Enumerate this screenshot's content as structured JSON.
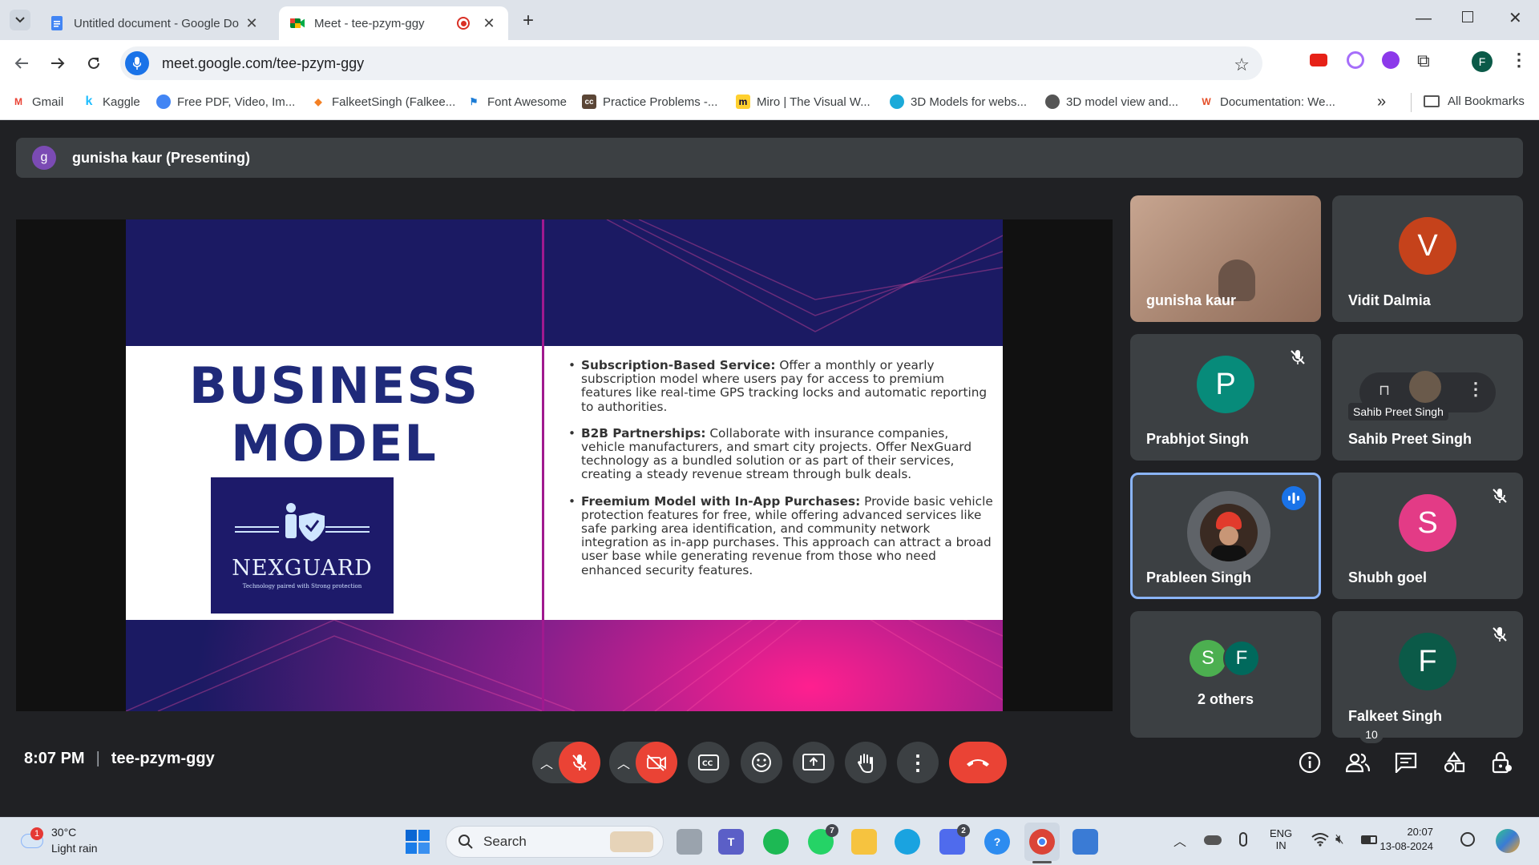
{
  "tabs": [
    {
      "title": "Untitled document - Google Do",
      "active": false
    },
    {
      "title": "Meet - tee-pzym-ggy",
      "active": true
    }
  ],
  "address": {
    "url": "meet.google.com/tee-pzym-ggy"
  },
  "profile_initial": "F",
  "bookmarks": [
    {
      "label": "Gmail",
      "color": "#ea4335",
      "glyph": "M"
    },
    {
      "label": "Kaggle",
      "color": "#20beff",
      "glyph": "k"
    },
    {
      "label": "Free PDF, Video, Im...",
      "color": "#4285f4",
      "glyph": "◐"
    },
    {
      "label": "FalkeetSingh (Falkee...",
      "color": "#f48024",
      "glyph": "◆"
    },
    {
      "label": "Font Awesome",
      "color": "#1c7cd6",
      "glyph": "⚑"
    },
    {
      "label": "Practice Problems -...",
      "color": "#5b4636",
      "glyph": "cc"
    },
    {
      "label": "Miro | The Visual W...",
      "color": "#ffd02f",
      "glyph": "m"
    },
    {
      "label": "3D Models for webs...",
      "color": "#1caad9",
      "glyph": "◉"
    },
    {
      "label": "3D model view and...",
      "color": "#555555",
      "glyph": "◍"
    },
    {
      "label": "Documentation: We...",
      "color": "#e44d26",
      "glyph": "W"
    }
  ],
  "all_bookmarks": "All Bookmarks",
  "presenting": {
    "initial": "g",
    "label": "gunisha kaur (Presenting)"
  },
  "slide": {
    "title_line1": "BUSINESS",
    "title_line2": "MODEL",
    "logo_name": "NEXGUARD",
    "logo_tagline": "Technology paired with Strong protection",
    "bullets": [
      {
        "head": "Subscription-Based Service:",
        "body": " Offer a monthly or yearly subscription model where users pay for access to premium features like real-time GPS tracking locks and automatic reporting to authorities."
      },
      {
        "head": "B2B Partnerships:",
        "body": " Collaborate with insurance companies, vehicle manufacturers, and smart city projects. Offer NexGuard technology as a bundled solution or as part of their services, creating a steady revenue stream through bulk deals."
      },
      {
        "head": "Freemium Model with In-App Purchases:",
        "body": " Provide basic vehicle protection features for free, while offering advanced services like safe parking area identification, and community network integration as in-app purchases. This approach can attract a broad user base while generating revenue from those who need enhanced security features."
      }
    ]
  },
  "participants": [
    {
      "name": "gunisha kaur",
      "type": "video"
    },
    {
      "name": "Vidit Dalmia",
      "initial": "V",
      "color": "#c5421b"
    },
    {
      "name": "Prabhjot Singh",
      "initial": "P",
      "color": "#078b7a",
      "muted": true
    },
    {
      "name": "Sahib Preet Singh",
      "hover_label": "Sahib Preet Singh"
    },
    {
      "name": "Prableen Singh",
      "speaking": true
    },
    {
      "name": "Shubh goel",
      "initial": "S",
      "color": "#e33b86",
      "muted": true
    },
    {
      "name": "2 others",
      "initials": [
        "S",
        "F"
      ],
      "colors": [
        "#4caf50",
        "#00695c"
      ]
    },
    {
      "name": "Falkeet Singh",
      "initial": "F",
      "color": "#0b5a48",
      "muted": true
    }
  ],
  "bottom": {
    "time": "8:07 PM",
    "code": "tee-pzym-ggy",
    "people_count": "10"
  },
  "taskbar": {
    "weather_temp": "30°C",
    "weather_desc": "Light rain",
    "weather_badge": "1",
    "search": "Search",
    "whatsapp_badge": "7",
    "store_badge": "2",
    "lang1": "ENG",
    "lang2": "IN",
    "clock_time": "20:07",
    "clock_date": "13-08-2024"
  }
}
